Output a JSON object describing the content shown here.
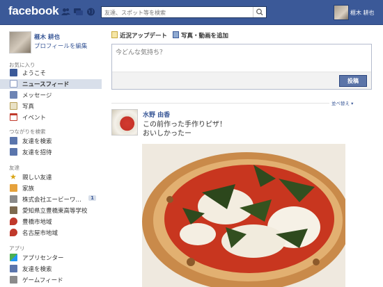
{
  "topbar": {
    "logo": "facebook",
    "search_placeholder": "友達、スポット等を検索",
    "user_name": "榧木 耕也"
  },
  "sidebar": {
    "user": {
      "name": "榧木 耕也",
      "edit_profile": "プロフィールを編集"
    },
    "favorites_title": "お気に入り",
    "favorites": [
      {
        "label": "ようこそ",
        "icon": "welcome-icon"
      },
      {
        "label": "ニュースフィード",
        "icon": "news-feed-icon"
      },
      {
        "label": "メッセージ",
        "icon": "messages-icon"
      },
      {
        "label": "写真",
        "icon": "photos-icon"
      },
      {
        "label": "イベント",
        "icon": "events-icon"
      }
    ],
    "find_friends_title": "つながりを検索",
    "find_friends": [
      {
        "label": "友達を検索",
        "icon": "find-friends-icon"
      },
      {
        "label": "友達を招待",
        "icon": "invite-friends-icon"
      }
    ],
    "friends_title": "友達",
    "friends": [
      {
        "label": "親しい友達",
        "icon": "star-icon"
      },
      {
        "label": "家族",
        "icon": "family-icon"
      },
      {
        "label": "株式会社エービーワ…",
        "icon": "company-icon",
        "badge": "1"
      },
      {
        "label": "愛知県立豊橋東高等学校",
        "icon": "school-icon"
      },
      {
        "label": "豊橋市地域",
        "icon": "location-icon"
      },
      {
        "label": "名古屋市地域",
        "icon": "location-icon"
      }
    ],
    "apps_title": "アプリ",
    "apps": [
      {
        "label": "アプリセンター",
        "icon": "app-center-icon"
      },
      {
        "label": "友達を検索",
        "icon": "find-friends-icon"
      },
      {
        "label": "ゲームフィード",
        "icon": "game-feed-icon"
      }
    ]
  },
  "composer": {
    "tab_status": "近況アップデート",
    "tab_photo": "写真・動画を追加",
    "placeholder": "今どんな気持ち？",
    "post_button": "投稿"
  },
  "feed": {
    "sort_label": "並べ替え ▾",
    "story": {
      "author": "水野 由香",
      "message": "この前作った手作りピザ！\nおいしかったー"
    }
  },
  "colors": {
    "brand": "#3b5998",
    "selected_nav": "#d8dfea",
    "post_button": "#5b74a8"
  }
}
